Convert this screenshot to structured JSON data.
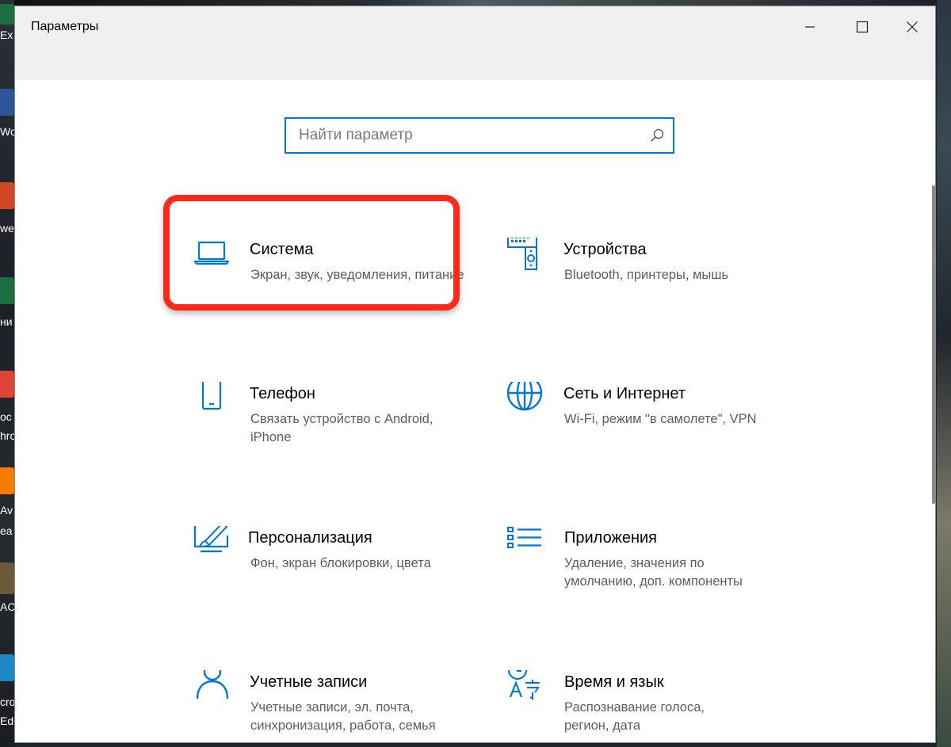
{
  "window": {
    "title": "Параметры"
  },
  "controls": {
    "minimize_icon": "minimize-icon",
    "maximize_icon": "maximize-icon",
    "close_icon": "close-icon"
  },
  "search": {
    "placeholder": "Найти параметр",
    "value": "",
    "icon": "search-icon"
  },
  "colors": {
    "accent": "#0078d7",
    "highlight": "#fd2a1a",
    "description": "#5d5d5d"
  },
  "tiles": [
    {
      "title": "Система",
      "description": "Экран, звук, уведомления, питание",
      "icon": "laptop-icon"
    },
    {
      "title": "Устройства",
      "description": "Bluetooth, принтеры, мышь",
      "icon": "devices-icon"
    },
    {
      "title": "Телефон",
      "description": "Связать устройство с Android, iPhone",
      "icon": "phone-icon"
    },
    {
      "title": "Сеть и Интернет",
      "description": "Wi-Fi, режим \"в самолете\", VPN",
      "icon": "globe-icon"
    },
    {
      "title": "Персонализация",
      "description": "Фон, экран блокировки, цвета",
      "icon": "personalization-icon"
    },
    {
      "title": "Приложения",
      "description": "Удаление, значения по умолчанию, доп. компоненты",
      "icon": "apps-list-icon"
    },
    {
      "title": "Учетные записи",
      "description": "Учетные записи, эл. почта, синхронизация, работа, семья",
      "icon": "user-icon"
    },
    {
      "title": "Время и язык",
      "description": "Распознавание голоса, регион, дата",
      "icon": "time-language-icon"
    }
  ],
  "desktop": {
    "left_labels": [
      "Ex",
      "Wo",
      "we",
      "ни",
      "oc",
      "hro",
      "Av",
      "ea",
      "AC",
      "cro",
      "Ed"
    ]
  }
}
